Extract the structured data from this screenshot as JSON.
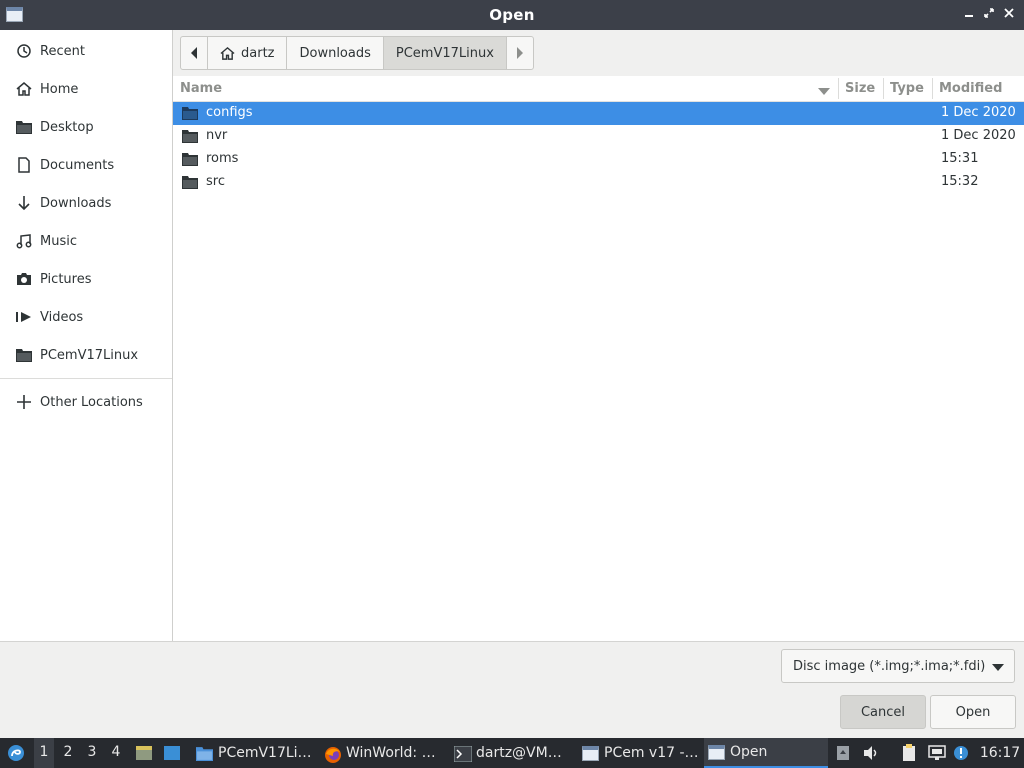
{
  "window": {
    "title": "Open"
  },
  "sidebar": {
    "items": [
      {
        "label": "Recent",
        "icon": "clock-icon"
      },
      {
        "label": "Home",
        "icon": "home-icon"
      },
      {
        "label": "Desktop",
        "icon": "folder-icon"
      },
      {
        "label": "Documents",
        "icon": "document-icon"
      },
      {
        "label": "Downloads",
        "icon": "download-arrow-icon"
      },
      {
        "label": "Music",
        "icon": "music-note-icon"
      },
      {
        "label": "Pictures",
        "icon": "camera-icon"
      },
      {
        "label": "Videos",
        "icon": "video-icon"
      },
      {
        "label": "PCemV17Linux",
        "icon": "folder-icon"
      }
    ],
    "other_locations": "Other Locations"
  },
  "pathbar": {
    "segments": [
      "dartz",
      "Downloads",
      "PCemV17Linux"
    ],
    "active": "PCemV17Linux"
  },
  "columns": {
    "name": "Name",
    "size": "Size",
    "type": "Type",
    "modified": "Modified"
  },
  "files": [
    {
      "name": "configs",
      "modified": "1 Dec 2020",
      "selected": true
    },
    {
      "name": "nvr",
      "modified": "1 Dec 2020",
      "selected": false
    },
    {
      "name": "roms",
      "modified": "15:31",
      "selected": false
    },
    {
      "name": "src",
      "modified": "15:32",
      "selected": false
    }
  ],
  "filter": {
    "value": "Disc image (*.img;*.ima;*.fdi)"
  },
  "buttons": {
    "cancel": "Cancel",
    "open": "Open"
  },
  "taskbar": {
    "workspaces": [
      "1",
      "2",
      "3",
      "4"
    ],
    "active_workspace": "1",
    "tasks": [
      {
        "label": "PCemV17Li…",
        "icon": "folder-icon"
      },
      {
        "label": "WinWorld: …",
        "icon": "firefox-icon"
      },
      {
        "label": "dartz@VM…",
        "icon": "terminal-icon"
      },
      {
        "label": "PCem v17 -…",
        "icon": "window-icon"
      },
      {
        "label": "Open",
        "icon": "window-icon"
      }
    ],
    "clock": "16:17"
  },
  "colors": {
    "selection": "#3d8ee5",
    "titlebar": "#3c4049",
    "taskbar": "#272a2f"
  }
}
